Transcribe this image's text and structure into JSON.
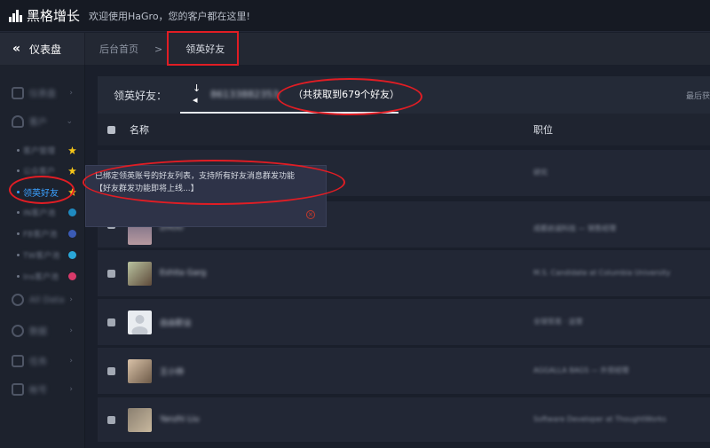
{
  "app": {
    "logo_text": "黑格增长",
    "welcome": "欢迎使用HaGro，您的客户都在这里!"
  },
  "crumbbar": {
    "dashboard_label": "仪表盘",
    "chevron": "«",
    "home": "后台首页",
    "separator": ">",
    "current": "领英好友"
  },
  "sidebar": {
    "items": [
      {
        "label": "仪表盘",
        "icon": "home-icon"
      },
      {
        "label": "客户",
        "icon": "user-icon"
      },
      {
        "label": "All Data",
        "icon": "data-icon"
      },
      {
        "label": "数据",
        "icon": "chart-icon"
      },
      {
        "label": "任务",
        "icon": "task-icon"
      },
      {
        "label": "帐号",
        "icon": "lock-icon"
      }
    ],
    "sub_items": [
      {
        "label": "客户管理"
      },
      {
        "label": "公众客户"
      },
      {
        "label": "领英好友"
      },
      {
        "label": "IN客户池"
      },
      {
        "label": "FB客户池"
      },
      {
        "label": "TW客户池"
      },
      {
        "label": "Ins客户池"
      }
    ]
  },
  "tabbar": {
    "label": "领英好友：",
    "account_prefix": "↓ ◂",
    "account": "86133882353",
    "count_text": "（共获取到679个好友）",
    "sort_text": "最后获"
  },
  "table": {
    "headers": {
      "name": "名称",
      "position": "职位"
    },
    "rows": [
      {
        "name": "",
        "position": "研究"
      },
      {
        "name": "ZHOU",
        "position": "成都启诚科技 — 销售经理"
      },
      {
        "name": "Eshita Garg",
        "position": "M.S. Candidate at Columbia University"
      },
      {
        "name": "自由职业",
        "position": "全球贸易 · 运营"
      },
      {
        "name": "王小帅",
        "position": "AGGALLA BAGS — 外贸经理"
      },
      {
        "name": "Yanzhi Liu",
        "position": "Software Developer at ThoughtWorks"
      }
    ]
  },
  "tooltip": {
    "line1": "已绑定领英账号的好友列表，支持所有好友消息群发功能",
    "line2": "【好友群发功能即将上线...】",
    "close": "×"
  },
  "colors": {
    "accent": "#3aa0ff",
    "annotation": "#e11d24",
    "star": "#f5c518"
  }
}
